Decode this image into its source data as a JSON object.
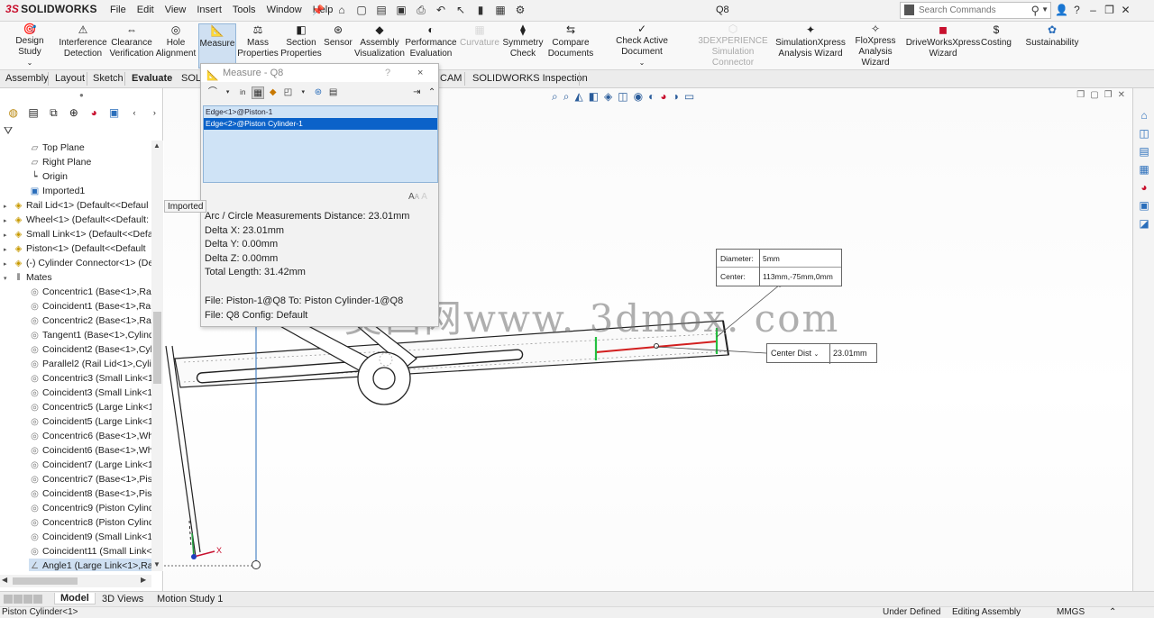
{
  "app": {
    "brand_ds": "3S",
    "brand_name": "SOLIDWORKS",
    "menus": [
      "File",
      "Edit",
      "View",
      "Insert",
      "Tools",
      "Window",
      "Help"
    ],
    "document_title": "Q8",
    "search_placeholder": "Search Commands"
  },
  "ribbon": {
    "items": [
      {
        "label1": "Design Study",
        "label2": "",
        "icon": "design-study-icon"
      },
      {
        "label1": "Interference",
        "label2": "Detection",
        "icon": "interference-icon"
      },
      {
        "label1": "Clearance",
        "label2": "Verification",
        "icon": "clearance-icon"
      },
      {
        "label1": "Hole",
        "label2": "Alignment",
        "icon": "hole-icon"
      },
      {
        "label1": "Measure",
        "label2": "",
        "icon": "measure-icon"
      },
      {
        "label1": "Mass",
        "label2": "Properties",
        "icon": "mass-icon"
      },
      {
        "label1": "Section",
        "label2": "Properties",
        "icon": "section-icon"
      },
      {
        "label1": "Sensor",
        "label2": "",
        "icon": "sensor-icon"
      },
      {
        "label1": "Assembly",
        "label2": "Visualization",
        "icon": "assembly-viz-icon"
      },
      {
        "label1": "Performance",
        "label2": "Evaluation",
        "icon": "performance-icon"
      },
      {
        "label1": "Curvature",
        "label2": "",
        "icon": "curvature-icon"
      },
      {
        "label1": "Symmetry",
        "label2": "Check",
        "icon": "symmetry-icon"
      },
      {
        "label1": "Compare",
        "label2": "Documents",
        "icon": "compare-icon"
      },
      {
        "label1": "Check Active Document",
        "label2": "",
        "icon": "check-doc-icon"
      },
      {
        "label1": "3DEXPERIENCE",
        "label2": "Simulation Connector",
        "icon": "3dx-icon"
      },
      {
        "label1": "SimulationXpress",
        "label2": "Analysis Wizard",
        "icon": "simxpress-icon"
      },
      {
        "label1": "FloXpress",
        "label2": "Analysis Wizard",
        "icon": "floxpress-icon"
      },
      {
        "label1": "DriveWorksXpress",
        "label2": "Wizard",
        "icon": "driveworks-icon"
      },
      {
        "label1": "Costing",
        "label2": "",
        "icon": "costing-icon"
      },
      {
        "label1": "Sustainability",
        "label2": "",
        "icon": "sustainability-icon"
      }
    ]
  },
  "tabs": [
    "Assembly",
    "Layout",
    "Sketch",
    "Evaluate",
    "SOLI",
    "CAM",
    "SOLIDWORKS Inspection"
  ],
  "tree": {
    "items": [
      {
        "label": "Top Plane",
        "icon": "plane-icon",
        "expand": ""
      },
      {
        "label": "Right Plane",
        "icon": "plane-icon",
        "expand": ""
      },
      {
        "label": "Origin",
        "icon": "origin-icon",
        "expand": ""
      },
      {
        "label": "Imported1",
        "icon": "imported-icon",
        "expand": ""
      },
      {
        "label": "Rail Lid<1> (Default<<Defaul",
        "icon": "part-icon",
        "expand": "▸"
      },
      {
        "label": "Wheel<1> (Default<<Default:",
        "icon": "part-icon",
        "expand": "▸"
      },
      {
        "label": "Small Link<1> (Default<<Defa",
        "icon": "part-icon",
        "expand": "▸"
      },
      {
        "label": "Piston<1> (Default<<Default",
        "icon": "part-icon",
        "expand": "▸"
      },
      {
        "label": "(-) Cylinder Connector<1> (De",
        "icon": "part-icon",
        "expand": "▸"
      },
      {
        "label": "Mates",
        "icon": "mates-icon",
        "expand": "▾"
      },
      {
        "label": "Concentric1 (Base<1>,Rail",
        "icon": "mate-icon",
        "expand": ""
      },
      {
        "label": "Coincident1 (Base<1>,Rail",
        "icon": "mate-icon",
        "expand": ""
      },
      {
        "label": "Concentric2 (Base<1>,Rail",
        "icon": "mate-icon",
        "expand": ""
      },
      {
        "label": "Tangent1 (Base<1>,Cylinde",
        "icon": "mate-icon",
        "expand": ""
      },
      {
        "label": "Coincident2 (Base<1>,Cylin",
        "icon": "mate-icon",
        "expand": ""
      },
      {
        "label": "Parallel2 (Rail Lid<1>,Cylin",
        "icon": "mate-icon",
        "expand": ""
      },
      {
        "label": "Concentric3 (Small Link<1:",
        "icon": "mate-icon",
        "expand": ""
      },
      {
        "label": "Coincident3 (Small Link<1:",
        "icon": "mate-icon",
        "expand": ""
      },
      {
        "label": "Concentric5 (Large Link<1:",
        "icon": "mate-icon",
        "expand": ""
      },
      {
        "label": "Coincident5 (Large Link<1:",
        "icon": "mate-icon",
        "expand": ""
      },
      {
        "label": "Concentric6 (Base<1>,Whe",
        "icon": "mate-icon",
        "expand": ""
      },
      {
        "label": "Coincident6 (Base<1>,Whe",
        "icon": "mate-icon",
        "expand": ""
      },
      {
        "label": "Coincident7 (Large Link<1:",
        "icon": "mate-icon",
        "expand": ""
      },
      {
        "label": "Concentric7 (Base<1>,Pisto",
        "icon": "mate-icon",
        "expand": ""
      },
      {
        "label": "Coincident8 (Base<1>,Pisto",
        "icon": "mate-icon",
        "expand": ""
      },
      {
        "label": "Concentric9 (Piston Cylind",
        "icon": "mate-icon",
        "expand": ""
      },
      {
        "label": "Concentric8 (Piston Cylinde",
        "icon": "mate-icon",
        "expand": ""
      },
      {
        "label": "Coincident9 (Small Link<1:",
        "icon": "mate-icon",
        "expand": ""
      },
      {
        "label": "Coincident11 (Small Link<",
        "icon": "mate-icon",
        "expand": ""
      },
      {
        "label": "Angle1 (Large Link<1>,Rail",
        "icon": "angle-icon",
        "expand": ""
      }
    ],
    "tooltip": "Imported"
  },
  "measure": {
    "title": "Measure - Q8",
    "help": "?",
    "close": "×",
    "selections": [
      "Edge<1>@Piston-1",
      "Edge<2>@Piston Cylinder-1"
    ],
    "aa": "A",
    "results": [
      "Arc / Circle Measurements Distance: 23.01mm",
      "Delta X: 23.01mm",
      "Delta Y: 0.00mm",
      "Delta Z: 0.00mm",
      "Total Length: 31.42mm"
    ],
    "file_lines": [
      "File: Piston-1@Q8 To: Piston Cylinder-1@Q8",
      "File: Q8 Config: Default"
    ]
  },
  "callout": {
    "diameter_label": "Diameter:",
    "diameter_value": "5mm",
    "center_label": "Center:",
    "center_value": "113mm,-75mm,0mm",
    "center_dist_label": "Center Dist",
    "center_dist_value": "23.01mm"
  },
  "watermark": "莫西网www. 3dmox. com",
  "bottom_tabs": [
    "Model",
    "3D Views",
    "Motion Study 1"
  ],
  "status": {
    "left": "Piston Cylinder<1>",
    "definition": "Under Defined",
    "mode": "Editing Assembly",
    "units": "MMGS"
  },
  "colors": {
    "accent": "#0b62c9",
    "selection_list": "#cfe3f6",
    "measure_line": "#d21f1f",
    "edge_highlight": "#24c040"
  }
}
